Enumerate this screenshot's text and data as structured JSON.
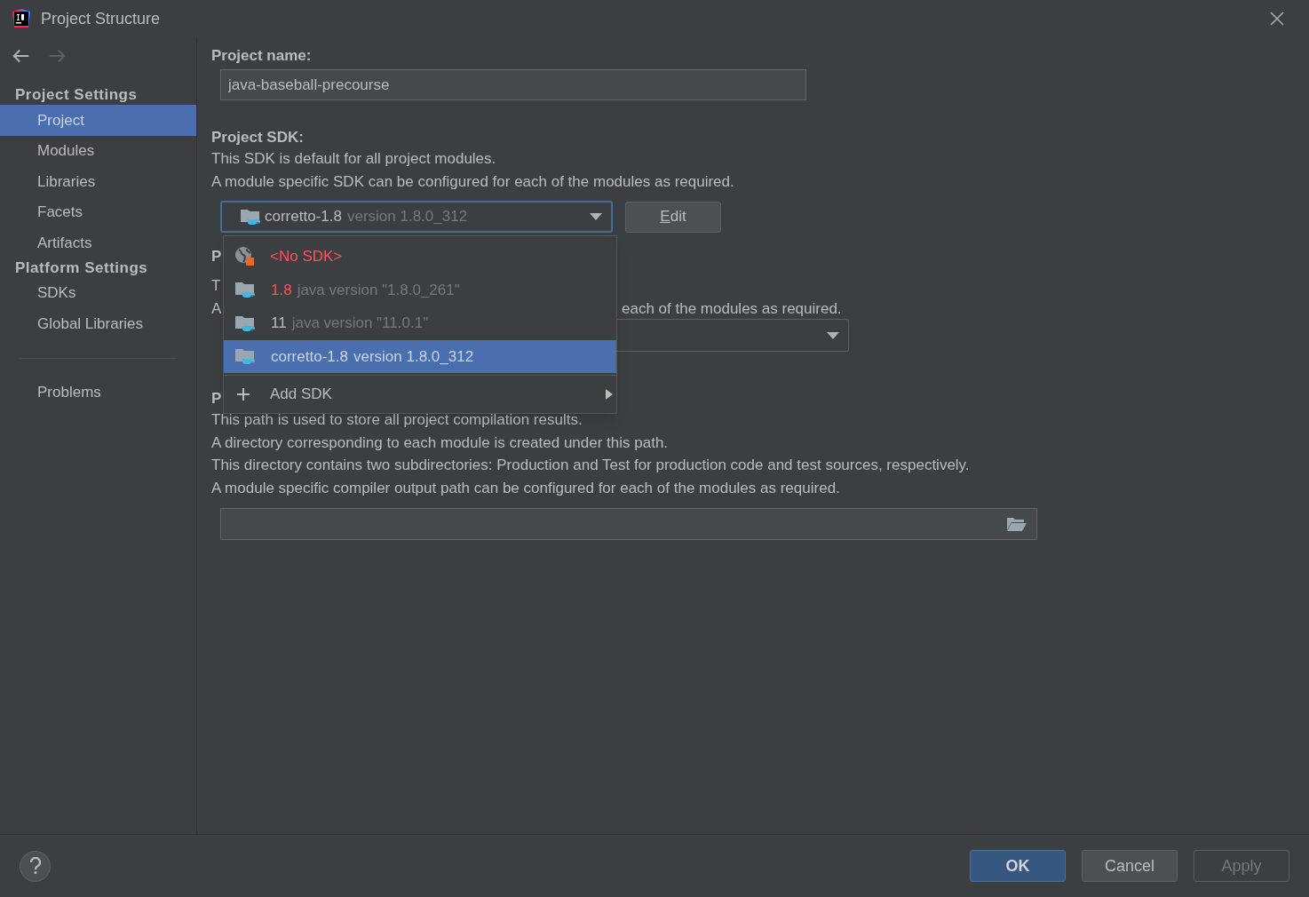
{
  "window": {
    "title": "Project Structure"
  },
  "navigation": [
    {
      "kind": "back",
      "disabled": false
    },
    {
      "kind": "forward",
      "disabled": true
    }
  ],
  "sidebar": {
    "sections": [
      {
        "heading": "Project Settings",
        "items": [
          {
            "label": "Project",
            "selected": true
          },
          {
            "label": "Modules",
            "selected": false
          },
          {
            "label": "Libraries",
            "selected": false
          },
          {
            "label": "Facets",
            "selected": false
          },
          {
            "label": "Artifacts",
            "selected": false
          }
        ]
      },
      {
        "heading": "Platform Settings",
        "items": [
          {
            "label": "SDKs",
            "selected": false
          },
          {
            "label": "Global Libraries",
            "selected": false
          }
        ]
      },
      {
        "items": [
          {
            "label": "Problems",
            "selected": false
          }
        ]
      }
    ]
  },
  "project_name": {
    "label": "Project name:",
    "value": "java-baseball-precourse"
  },
  "project_sdk": {
    "label": "Project SDK:",
    "descriptions": [
      "This SDK is default for all project modules.",
      "A module specific SDK can be configured for each of the modules as required."
    ],
    "combo": {
      "name": "corretto-1.8",
      "version": "version 1.8.0_312"
    },
    "edit_button": "Edit"
  },
  "sdk_popup": {
    "items": [
      {
        "kind": "none",
        "name": "<No SDK>",
        "selected": false
      },
      {
        "kind": "sdk",
        "name": "1.8",
        "version": "java version \"1.8.0_261\"",
        "invalid": true,
        "selected": false
      },
      {
        "kind": "sdk",
        "name": "11",
        "version": "java version \"11.0.1\"",
        "invalid": false,
        "selected": false
      },
      {
        "kind": "sdk",
        "name": "corretto-1.8",
        "version": "version 1.8.0_312",
        "invalid": false,
        "selected": true
      }
    ],
    "action": {
      "label": "Add SDK",
      "submenu": true
    }
  },
  "language_level": {
    "label": "P",
    "description_start": "T",
    "description_2_start": "A",
    "description_2_end": "each of the modules as required."
  },
  "compiler_output": {
    "label": "P",
    "descriptions": [
      "This path is used to store all project compilation results.",
      "A directory corresponding to each module is created under this path.",
      "This directory contains two subdirectories: Production and Test for production code and test sources, respectively.",
      "A module specific compiler output path can be configured for each of the modules as required."
    ]
  },
  "footer": {
    "buttons": [
      {
        "label": "OK",
        "kind": "default",
        "disabled": false
      },
      {
        "label": "Cancel",
        "kind": "normal",
        "disabled": false
      },
      {
        "label": "Apply",
        "kind": "normal",
        "disabled": true
      }
    ]
  }
}
